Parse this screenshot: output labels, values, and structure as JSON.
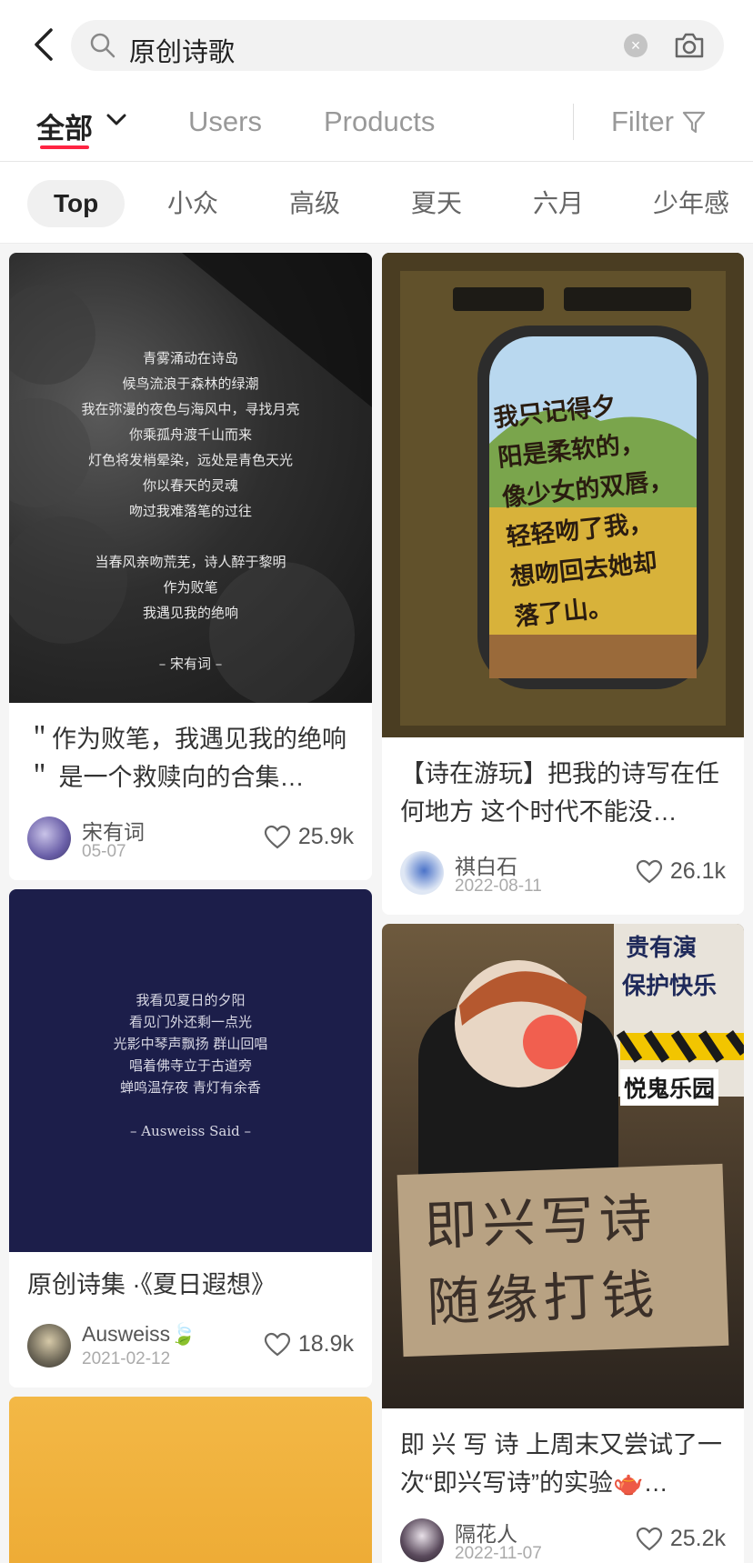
{
  "search": {
    "query": "原创诗歌"
  },
  "tabs": {
    "all": "全部",
    "users": "Users",
    "products": "Products",
    "filter": "Filter"
  },
  "chips": [
    "Top",
    "小众",
    "高级",
    "夏天",
    "六月",
    "少年感"
  ],
  "cards": [
    {
      "poem_lines": [
        "青雾涌动在诗岛",
        "候鸟流浪于森林的绿潮",
        "我在弥漫的夜色与海风中，寻找月亮",
        "你乘孤舟渡千山而来",
        "灯色将发梢晕染，远处是青色天光",
        "你以春天的灵魂",
        "吻过我难落笔的过往",
        "",
        "当春风亲吻荒芜，诗人醉于黎明",
        "作为败笔",
        "我遇见我的绝响",
        "",
        "– 宋有词 –"
      ],
      "title": "＂作为败笔，我遇见我的绝响＂ 是一个救赎向的合集…",
      "author": "宋有词",
      "date": "05-07",
      "likes": "25.9k"
    },
    {
      "window_text": [
        "我只记得夕",
        "阳是柔软的，",
        "像少女的双唇，",
        "轻轻吻了我，",
        "想吻回去她却",
        "落了山。"
      ],
      "title": "【诗在游玩】把我的诗写在任何地方 这个时代不能没…",
      "author": "祺白石",
      "date": "2022-08-11",
      "likes": "26.1k"
    },
    {
      "poem_lines": [
        "我看见夏日的夕阳",
        "看见门外还剩一点光",
        "光影中琴声飘扬 群山回唱",
        "唱着佛寺立于古道旁",
        "蝉鸣温存夜 青灯有余香",
        "",
        "– Ausweiss Said –"
      ],
      "title": "原创诗集 ·《夏日遐想》",
      "author": "Ausweiss🍃",
      "date": "2021-02-12",
      "likes": "18.9k"
    },
    {
      "sign_top": "贵有演",
      "sign_mid": "保护快乐",
      "sign_bottom": "悦鬼乐园",
      "sign_text": [
        "即兴写诗",
        "随缘打钱"
      ],
      "title": "即 兴 写 诗 上周末又尝试了一次“即兴写诗”的实验🫖…",
      "author": "隔花人",
      "date": "2022-11-07",
      "likes": "25.2k"
    }
  ],
  "colors": {
    "accent": "#ff2442",
    "dark_navy": "#1c1e4a",
    "yellow": "#f1b13e"
  }
}
